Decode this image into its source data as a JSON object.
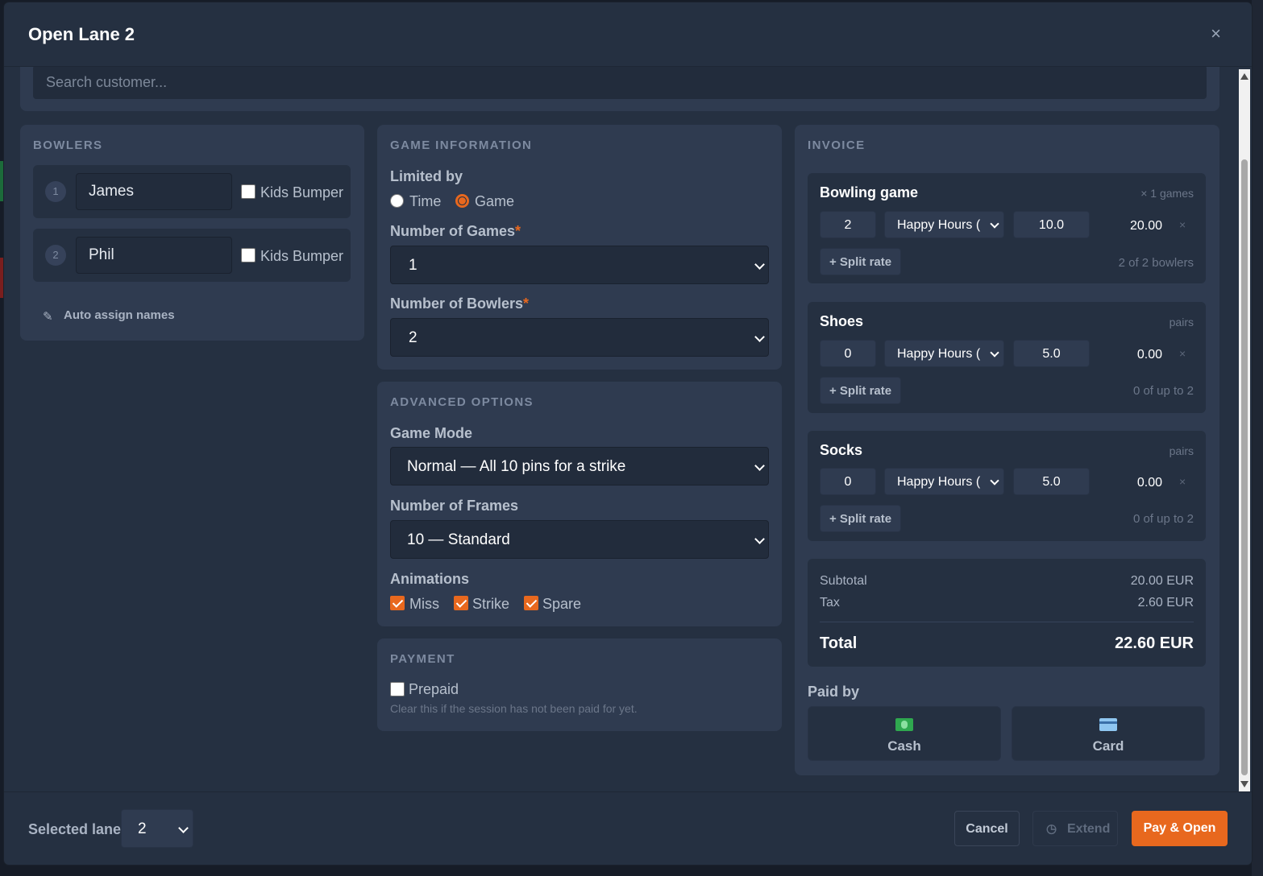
{
  "modal": {
    "title": "Open Lane 2",
    "close_glyph": "×"
  },
  "search": {
    "placeholder": "Search customer..."
  },
  "bowlers": {
    "title": "BOWLERS",
    "items": [
      {
        "number": "1",
        "name": "James",
        "kids_bumper_label": "Kids Bumper",
        "kids_bumper": false
      },
      {
        "number": "2",
        "name": "Phil",
        "kids_bumper_label": "Kids Bumper",
        "kids_bumper": false
      }
    ],
    "auto_assign_label": "Auto assign names",
    "pencil_glyph": "✎"
  },
  "game_info": {
    "title": "GAME INFORMATION",
    "limited_by_label": "Limited by",
    "options": [
      "Time",
      "Game"
    ],
    "selected_option": "Game",
    "games_label": "Number of Games",
    "games_value": "1",
    "bowlers_label": "Number of Bowlers",
    "bowlers_value": "2",
    "required_mark": "*"
  },
  "advanced": {
    "title": "ADVANCED OPTIONS",
    "mode_label": "Game Mode",
    "mode_value": "Normal — All 10 pins for a strike",
    "frames_label": "Number of Frames",
    "frames_value": "10 — Standard",
    "animations_label": "Animations",
    "animations": [
      {
        "label": "Miss",
        "checked": true
      },
      {
        "label": "Strike",
        "checked": true
      },
      {
        "label": "Spare",
        "checked": true
      }
    ]
  },
  "payment": {
    "title": "PAYMENT",
    "prepaid_label": "Prepaid",
    "prepaid": false,
    "help": "Clear this if the session has not been paid for yet."
  },
  "invoice": {
    "title": "INVOICE",
    "items": [
      {
        "name": "Bowling game",
        "meta": "× 1 games",
        "qty": "2",
        "rate": "Happy Hours (",
        "price": "10.0",
        "amount": "20.00",
        "split_label": "+ Split rate",
        "split_info": "2 of 2 bowlers"
      },
      {
        "name": "Shoes",
        "meta": "pairs",
        "qty": "0",
        "rate": "Happy Hours (",
        "price": "5.0",
        "amount": "0.00",
        "split_label": "+ Split rate",
        "split_info": "0 of up to 2"
      },
      {
        "name": "Socks",
        "meta": "pairs",
        "qty": "0",
        "rate": "Happy Hours (",
        "price": "5.0",
        "amount": "0.00",
        "split_label": "+ Split rate",
        "split_info": "0 of up to 2"
      }
    ],
    "remove_glyph": "×",
    "subtotal_label": "Subtotal",
    "subtotal": "20.00 EUR",
    "tax_label": "Tax",
    "tax": "2.60 EUR",
    "total_label": "Total",
    "total": "22.60 EUR",
    "paid_by_label": "Paid by",
    "methods": [
      {
        "label": "Cash",
        "icon": "cash-icon"
      },
      {
        "label": "Card",
        "icon": "card-icon"
      }
    ]
  },
  "footer": {
    "lane_label": "Selected lane",
    "lane_value": "2",
    "cancel_label": "Cancel",
    "extend_label": "Extend",
    "clock_glyph": "◷",
    "pay_label": "Pay & Open"
  },
  "colors": {
    "accent": "#e8681e",
    "modal_bg": "#253041",
    "panel_bg": "#2f3b50"
  }
}
